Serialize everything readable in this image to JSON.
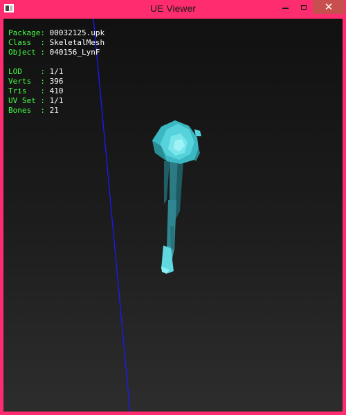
{
  "window": {
    "title": "UE Viewer",
    "close_glyph": "✕",
    "frame_color": "#ff2d6f",
    "close_color": "#c7504f"
  },
  "icons": {
    "app": "app-window-icon",
    "minimize": "minimize-icon",
    "maximize": "maximize-icon",
    "close": "close-icon"
  },
  "info": {
    "package": {
      "label": "Package:",
      "value": "00032125.upk"
    },
    "class": {
      "label": "Class  :",
      "value": "SkeletalMesh"
    },
    "object": {
      "label": "Object :",
      "value": "040156_LynF"
    },
    "lod": {
      "label": "LOD    :",
      "value": "1/1"
    },
    "verts": {
      "label": "Verts  :",
      "value": "396"
    },
    "tris": {
      "label": "Tris   :",
      "value": "410"
    },
    "uvset": {
      "label": "UV Set :",
      "value": "1/1"
    },
    "bones": {
      "label": "Bones  :",
      "value": "21"
    }
  },
  "colors": {
    "label_text": "#44ff44",
    "value_text": "#ffffff",
    "axis_line": "#1a1aff",
    "mesh": "#5fd8e0"
  }
}
